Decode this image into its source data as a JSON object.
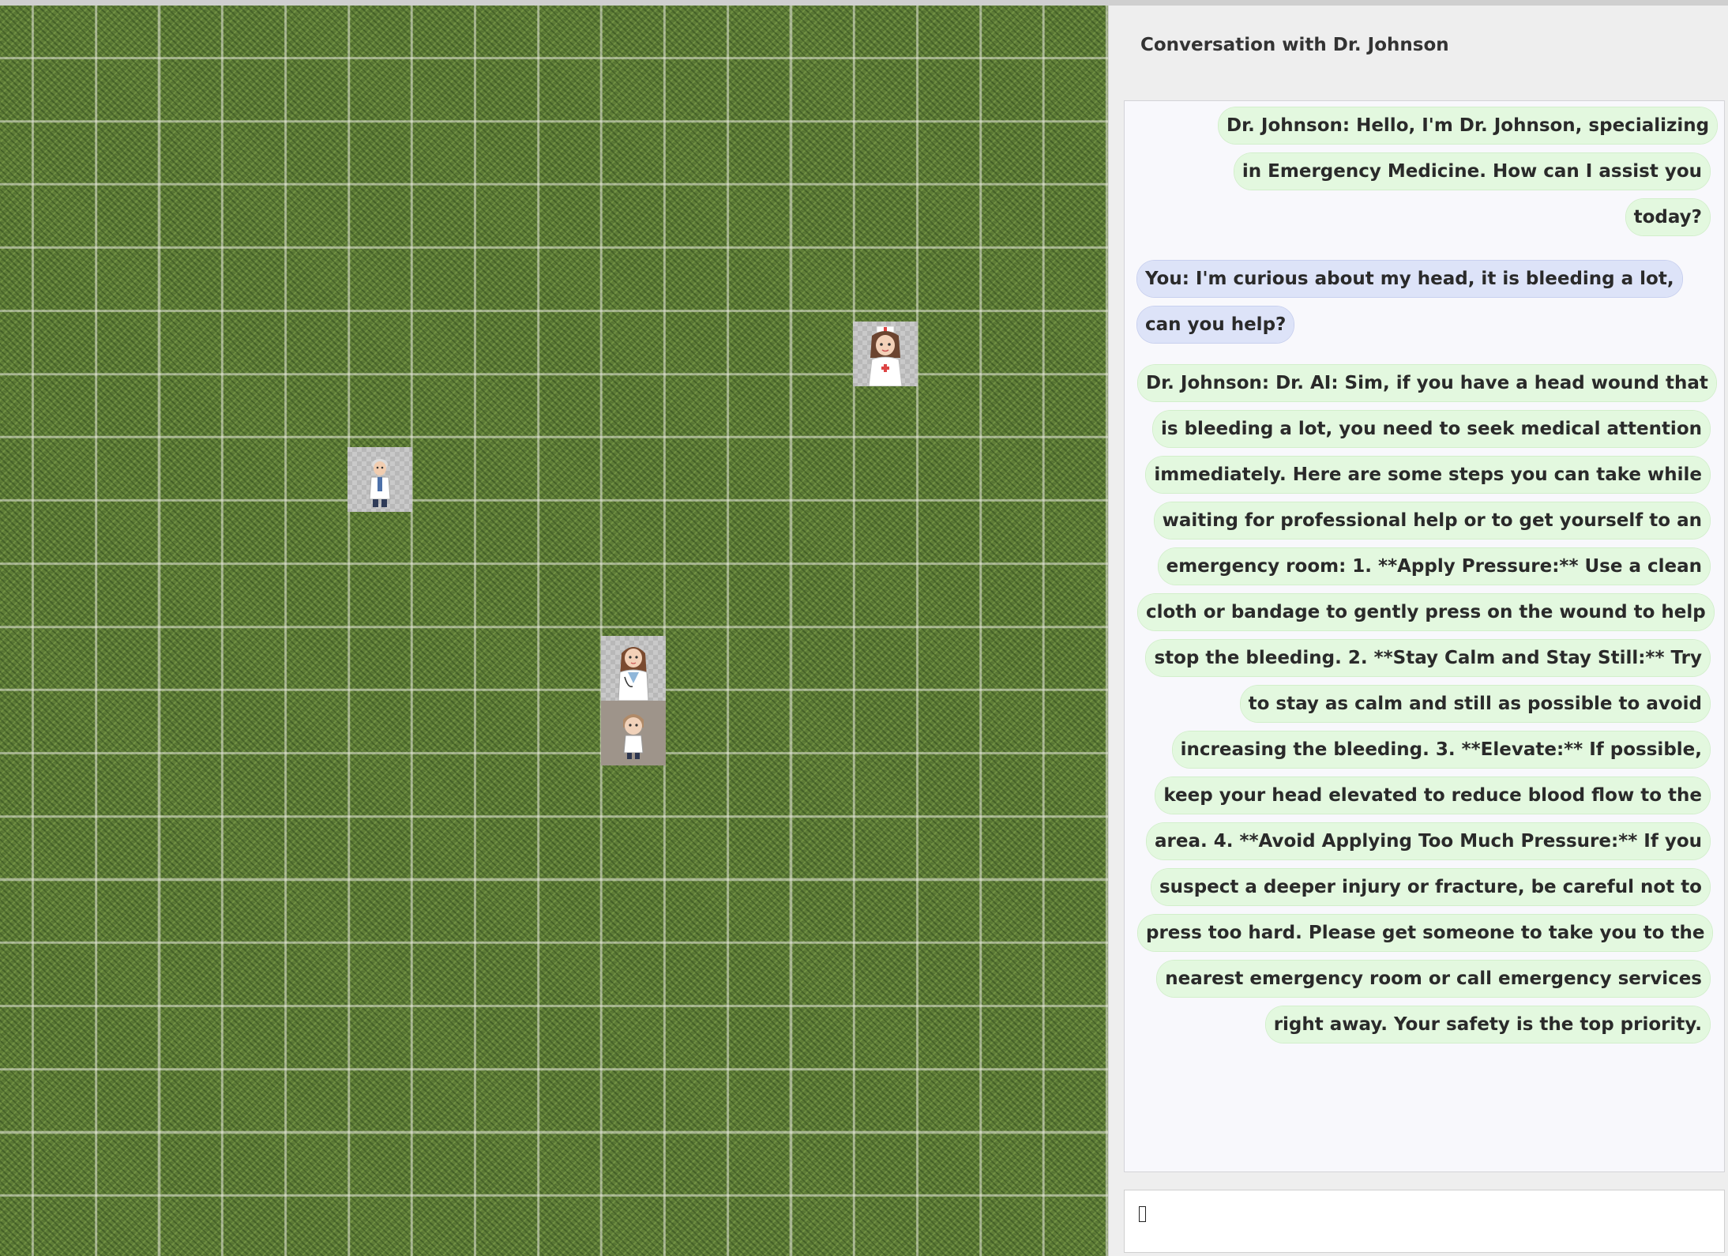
{
  "map": {
    "characters": [
      {
        "id": "nurse",
        "role": "nurse-npc"
      },
      {
        "id": "doctor-male",
        "role": "doctor-npc"
      },
      {
        "id": "doctor-female",
        "role": "doctor-npc"
      },
      {
        "id": "player",
        "role": "player"
      }
    ],
    "colors": {
      "grass": "#5f7d37",
      "grid": "#e6e6dc"
    }
  },
  "chat": {
    "title": "Conversation with Dr. Johnson",
    "messages": [
      {
        "sender": "npc",
        "text": "Dr. Johnson: Hello, I'm Dr. Johnson, specializing in Emergency Medicine. How can I assist you today?"
      },
      {
        "sender": "user",
        "text": "You: I'm curious about my head, it is bleeding a lot, can you help?"
      },
      {
        "sender": "npc",
        "text": "Dr. Johnson: Dr. AI: Sim, if you have a head wound that is bleeding a lot, you need to seek medical attention immediately. Here are some steps you can take while waiting for professional help or to get yourself to an emergency room: 1. **Apply Pressure:** Use a clean cloth or bandage to gently press on the wound to help stop the bleeding. 2. **Stay Calm and Stay Still:** Try to stay as calm and still as possible to avoid increasing the bleeding. 3. **Elevate:** If possible, keep your head elevated to reduce blood flow to the area. 4. **Avoid Applying Too Much Pressure:** If you suspect a deeper injury or fracture, be careful not to press too hard. Please get someone to take you to the nearest emergency room or call emergency services right away. Your safety is the top priority."
      }
    ],
    "input": {
      "value": "",
      "placeholder": ""
    },
    "colors": {
      "npc_bubble": "#e3f8df",
      "user_bubble": "#dde3f8"
    }
  }
}
